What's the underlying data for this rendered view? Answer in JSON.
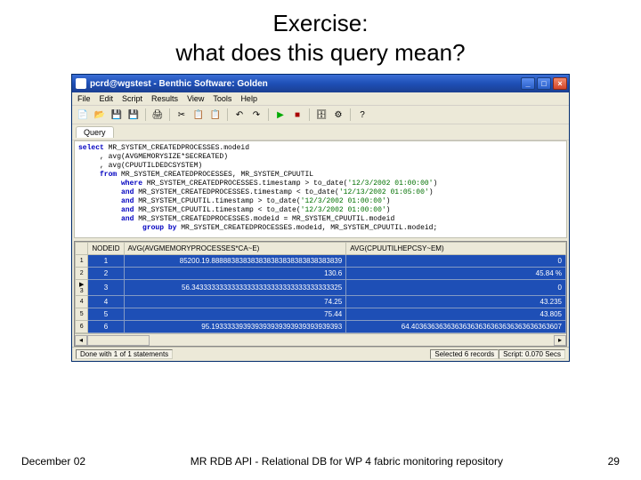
{
  "slide": {
    "title_line1": "Exercise:",
    "title_line2": "what does this query mean?"
  },
  "window": {
    "title": "pcrd@wgstest - Benthic Software: Golden",
    "controls": {
      "min": "_",
      "max": "□",
      "close": "×"
    }
  },
  "menu": [
    "File",
    "Edit",
    "Script",
    "Results",
    "View",
    "Tools",
    "Help"
  ],
  "toolbar_icons": [
    "new-icon",
    "open-icon",
    "save-icon",
    "save-all-icon",
    "print-icon",
    "cut-icon",
    "copy-icon",
    "paste-icon",
    "undo-icon",
    "redo-icon",
    "table-icon",
    "execute-icon",
    "stop-icon",
    "db-icon",
    "options-icon",
    "help-icon"
  ],
  "query_tab": "Query",
  "sql": {
    "l1a": "select ",
    "l1b": "MR_SYSTEM_CREATEDPROCESSES.modeid",
    "l2": "     , avg(AVGMEMORYSIZE*SECREATED)",
    "l3": "     , avg(CPUUTILDEDCSYSTEM)",
    "l4a": "     from ",
    "l4b": "MR_SYSTEM_CREATEDPROCESSES, MR_SYSTEM_CPUUTIL",
    "l5a": "          where ",
    "l5b": "MR_SYSTEM_CREATEDPROCESSES.timestamp > to_date(",
    "l5c": "'12/3/2002 01:00:00'",
    "l5d": ")",
    "l6a": "          and ",
    "l6b": "MR_SYSTEM_CREATEDPROCESSES.timestamp < to_date(",
    "l6c": "'12/13/2002 01:05:00'",
    "l6d": ")",
    "l7a": "          and ",
    "l7b": "MR_SYSTEM_CPUUTIL.timestamp > to_date(",
    "l7c": "'12/3/2002 01:00:00'",
    "l7d": ")",
    "l8a": "          and ",
    "l8b": "MR_SYSTEM_CPUUTIL.timestamp < to_date(",
    "l8c": "'12/3/2002 01:00:00'",
    "l8d": ")",
    "l9a": "          and ",
    "l9b": "MR_SYSTEM_CREATEDPROCESSES.modeid = MR_SYSTEM_CPUUTIL.modeid",
    "l10a": "               group by ",
    "l10b": "MR_SYSTEM_CREATEDPROCESSES.modeid, MR_SYSTEM_CPUUTIL.modeid;"
  },
  "grid": {
    "headers": [
      "",
      "NODEID",
      "AVG(AVGMEMORYPROCESSES*CA~E)",
      "AVG(CPUUTILHEPCSY~EM)"
    ],
    "rows": [
      {
        "ind": "",
        "n": "1",
        "c1": "1",
        "c2": "85200.19.888883838383838383838383838383839",
        "c3": "0"
      },
      {
        "ind": "",
        "n": "2",
        "c1": "2",
        "c2": "130.6",
        "c3": "45.84 %"
      },
      {
        "ind": "▶",
        "n": "3",
        "c1": "3",
        "c2": "56.34333333333333333333333333333333333325",
        "c3": "0"
      },
      {
        "ind": "",
        "n": "4",
        "c1": "4",
        "c2": "74.25",
        "c3": "43.235"
      },
      {
        "ind": "",
        "n": "5",
        "c1": "5",
        "c2": "75.44",
        "c3": "43.805"
      },
      {
        "ind": "",
        "n": "6",
        "c1": "6",
        "c2": "95.193333393939393939393939393939393",
        "c3": "64.40363636363636363636363636363636363607"
      }
    ]
  },
  "status": {
    "left": "Done with 1 of 1 statements",
    "mid": "Selected 6 records",
    "right": "Script: 0.070 Secs"
  },
  "footer": {
    "left": "December 02",
    "center": "MR RDB API - Relational DB for WP 4 fabric monitoring repository",
    "right": "29"
  }
}
